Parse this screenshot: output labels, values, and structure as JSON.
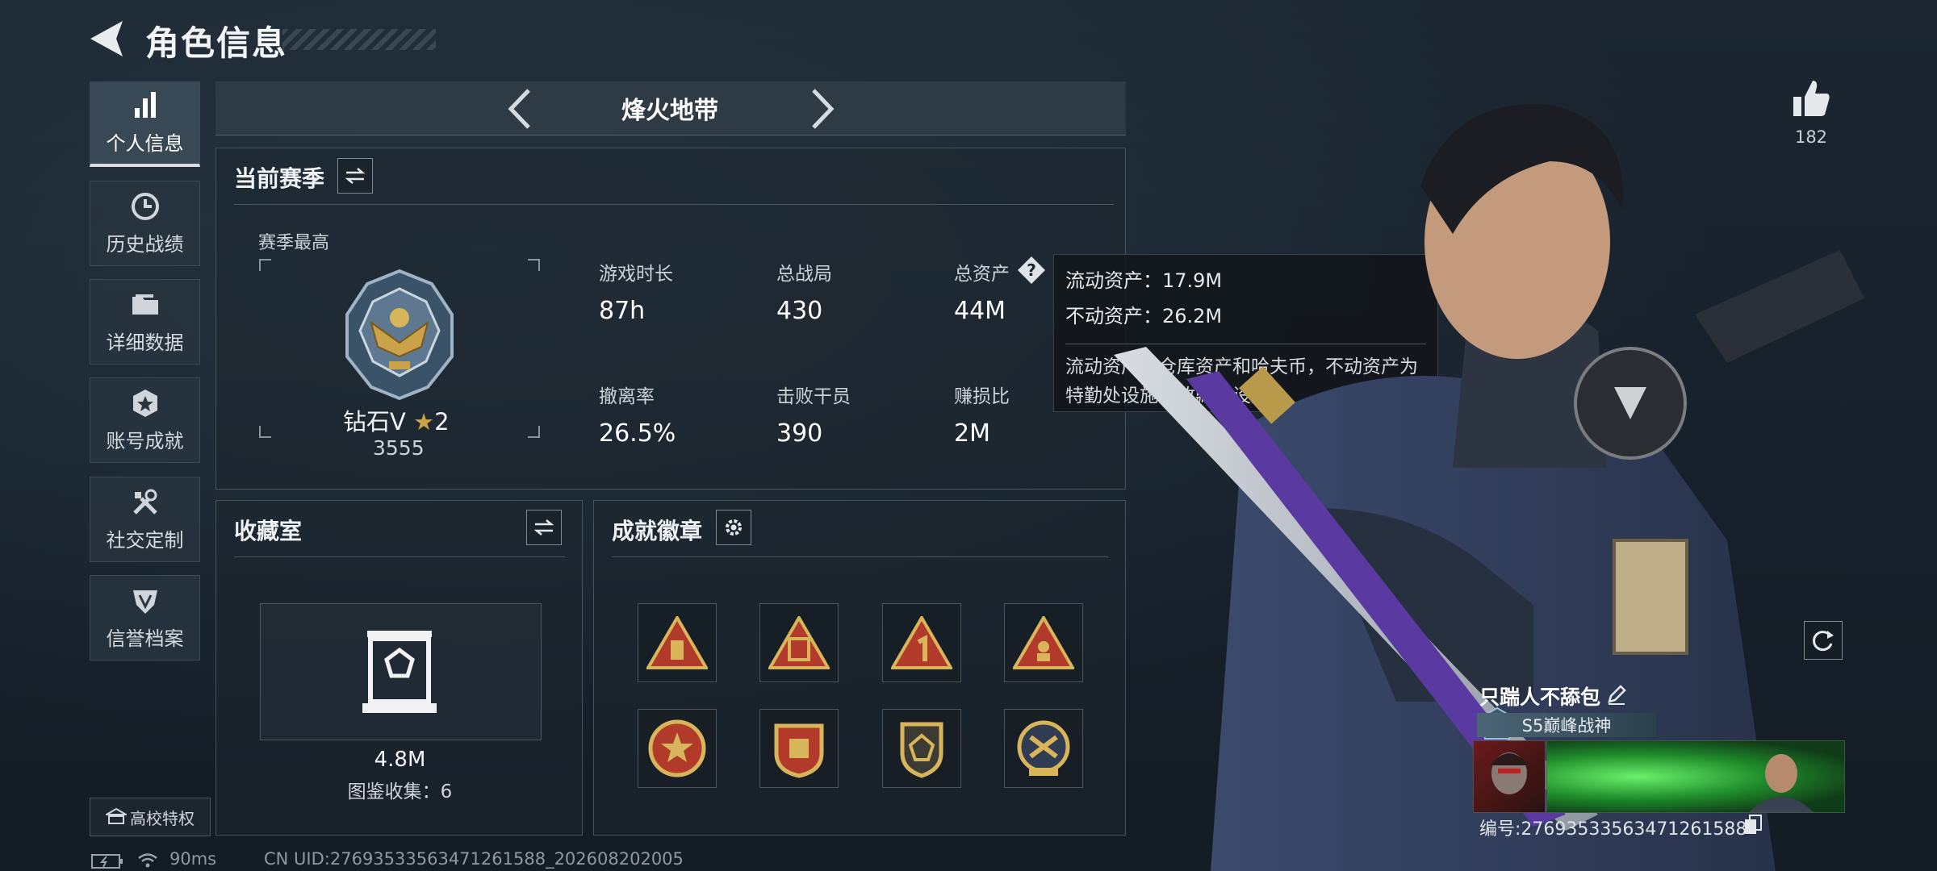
{
  "header": {
    "title": "角色信息"
  },
  "sidebar": {
    "items": [
      {
        "label": "个人信息",
        "icon": "bar-chart-icon",
        "active": true
      },
      {
        "label": "历史战绩",
        "icon": "clock-icon",
        "active": false
      },
      {
        "label": "详细数据",
        "icon": "folder-icon",
        "active": false
      },
      {
        "label": "账号成就",
        "icon": "medal-icon",
        "active": false
      },
      {
        "label": "社交定制",
        "icon": "tools-icon",
        "active": false
      },
      {
        "label": "信誉档案",
        "icon": "shield-badge-icon",
        "active": false
      }
    ],
    "campus_label": "高校特权"
  },
  "mode": {
    "name": "烽火地带"
  },
  "season": {
    "title": "当前赛季",
    "best_label": "赛季最高",
    "rank_name": "钻石V",
    "rank_stars": "2",
    "rank_score": "3555",
    "stats": [
      {
        "label": "游戏时长",
        "value": "87h"
      },
      {
        "label": "总战局",
        "value": "430"
      },
      {
        "label": "总资产",
        "value": "44M"
      },
      {
        "label": "撤离率",
        "value": "26.5%"
      },
      {
        "label": "击败干员",
        "value": "390"
      },
      {
        "label": "赚损比",
        "value": "2M"
      }
    ]
  },
  "tooltip": {
    "liquid": "流动资产：17.9M",
    "fixed": "不动资产：26.2M",
    "note": "流动资产为仓库资产和哈夫币，不动资产为特勤处设施和收藏室设施"
  },
  "collection": {
    "title": "收藏室",
    "value": "4.8M",
    "catalog": "图鉴收集：6"
  },
  "achievements": {
    "title": "成就徽章"
  },
  "status": {
    "ping": "90ms",
    "uid_text": "CN UID:2769353356347126158​8_202608202005"
  },
  "profile": {
    "likes": "182",
    "player_name": "只踹人不舔包",
    "title_tag": "S5巅峰战神",
    "uid": "编号:27693533563471261588"
  },
  "colors": {
    "accent_gold": "#c9a24a",
    "badge_red": "#b23a2a"
  }
}
